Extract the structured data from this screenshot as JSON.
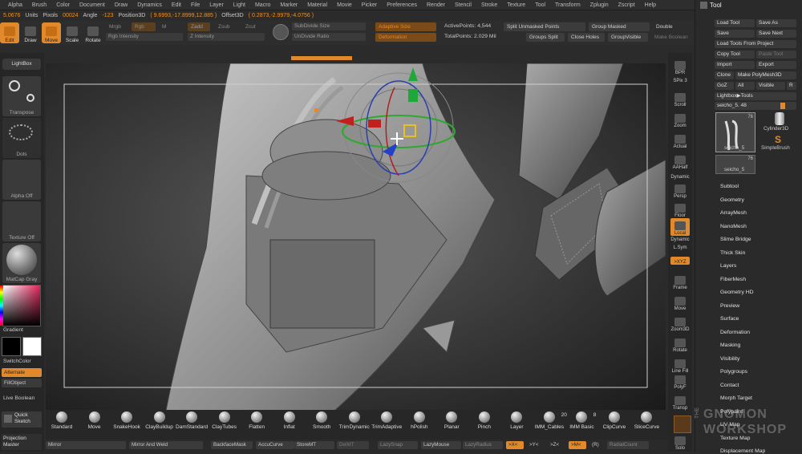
{
  "menu": [
    "Alpha",
    "Brush",
    "Color",
    "Document",
    "Draw",
    "Dynamics",
    "Edit",
    "File",
    "Layer",
    "Light",
    "Macro",
    "Marker",
    "Material",
    "Movie",
    "Picker",
    "Preferences",
    "Render",
    "Stencil",
    "Stroke",
    "Texture",
    "Tool",
    "Transform",
    "Zplugin",
    "Zscript",
    "Help"
  ],
  "status": {
    "units_val": "5.0676",
    "units": "Units",
    "pixols_lbl": "Pixols",
    "pixols": "00024",
    "angle_lbl": "Angle",
    "angle": "-123",
    "pos_lbl": "Position3D",
    "pos": "( 9.6993,-17.8999,12.885 )",
    "offset_lbl": "Offset3D",
    "offset": "( 0.2873,-2.9979,-4.0756 )"
  },
  "shelf": {
    "edit": "Edit",
    "draw": "Draw",
    "move": "Move",
    "scale": "Scale",
    "rotate": "Rotate",
    "mrgb": "Mrgb",
    "rgb": "Rgb",
    "m": "M",
    "zadd": "Zadd",
    "zsub": "Zsub",
    "zcut": "Zcut",
    "rgb_intensity": "Rgb Intensity",
    "z_intensity": "Z Intensity",
    "subdivide_size": "SubDivide Size",
    "undivide_ratio": "UnDivide Ratio",
    "adaptive_size": "Adaptive Size",
    "deformation": "Deformation",
    "active_points_lbl": "ActivePoints:",
    "active_points": "4,544",
    "total_points_lbl": "TotalPoints:",
    "total_points": "2.029 Mil",
    "split_unmasked": "Split Unmasked Points",
    "group_masked": "Group Masked",
    "double": "Double",
    "groups_split": "Groups Split",
    "close_holes": "Close Holes",
    "group_visible": "GroupVisible",
    "make_boolean": "Make Boolean"
  },
  "left": {
    "lightbox": "LightBox",
    "transpose": "Transpose",
    "dots": "Dots",
    "alpha_off": "Alpha Off",
    "texture_off": "Texture Off",
    "matcap": "MatCap Gray",
    "gradient": "Gradient",
    "switch_color": "SwitchColor",
    "alternate": "Alternate",
    "fill_object": "FillObject",
    "live_boolean": "Live Boolean",
    "quick_sketch": "Quick Sketch",
    "projection_master": "Projection Master"
  },
  "right": {
    "bpr": "BPR",
    "spix": "SPix 3",
    "scroll": "Scroll",
    "zoom": "Zoom",
    "actual": "Actual",
    "aahalf": "AAHalf",
    "dynamic": "Dynamic",
    "persp": "Persp",
    "floor": "Floor",
    "local": "Local",
    "dynamic2": "Dynamic",
    "lsym": "L.Sym",
    "xyz": ">XYZ",
    "frame": "Frame",
    "move": "Move",
    "zoom3d": "Zoom3D",
    "rotate": "Rotate",
    "line_fill": "Line Fill",
    "polyf": "PolyF",
    "transp": "Transp",
    "solo": "Solo"
  },
  "tool": {
    "title": "Tool",
    "load_tool": "Load Tool",
    "save_as": "Save As",
    "save": "Save",
    "save_next": "Save Next",
    "load_from_project": "Load Tools From Project",
    "copy_tool": "Copy Tool",
    "paste_tool": "Paste Tool",
    "import": "Import",
    "export": "Export",
    "clone": "Clone",
    "make_polymesh": "Make PolyMesh3D",
    "goz": "GoZ",
    "all": "All",
    "visible": "Visible",
    "r": "R",
    "lightbox_tools": "Lightbox▶Tools",
    "current_tool": "seicho_5.",
    "current_val": "48",
    "thumb1_label": "seicho_5",
    "thumb1_count": "76",
    "thumb2_label": "Cylinder3D",
    "thumb3_label": "SimpleBrush",
    "thumb4_label": "seicho_5",
    "thumb4_count": "76"
  },
  "subpalettes": [
    "Subtool",
    "Geometry",
    "ArrayMesh",
    "NanoMesh",
    "Slime Bridge",
    "Thick Skin",
    "Layers",
    "FiberMesh",
    "Geometry HD",
    "Preview",
    "Surface",
    "Deformation",
    "Masking",
    "Visibility",
    "Polygroups",
    "Contact",
    "Morph Target",
    "Polypaint",
    "UV Map",
    "Texture Map",
    "Displacement Map"
  ],
  "brushes": [
    "Standard",
    "Move",
    "SnakeHook",
    "ClayBuildup",
    "DamStandard",
    "ClayTubes",
    "Flatten",
    "Inflat",
    "Smooth",
    "TrimDynamic",
    "TrimAdaptive",
    "hPolish",
    "Planar",
    "Pinch",
    "Layer",
    "IMM_Cables",
    "IMM Basic",
    "ClipCurve",
    "SliceCurve"
  ],
  "brush_counts": {
    "imm_cables": "20",
    "imm_basic": "8"
  },
  "bottombar": {
    "mirror": "Mirror",
    "mirror_weld": "Mirror And Weld",
    "backface_mask": "BackfaceMask",
    "accucurve": "AccuCurve",
    "store_mt": "StoreMT",
    "del_mt": "DelMT",
    "lazy_snap": "LazySnap",
    "lazy_mouse": "LazyMouse",
    "lazy_radius": "LazyRadius",
    "x": ">X<",
    "y": ">Y<",
    "z": ">Z<",
    "m": ">M<",
    "r": "(R)",
    "radial": "RadialCount"
  },
  "watermark": {
    "the": "THE",
    "gnomon": "GNOMON",
    "workshop": "WORKSHOP"
  },
  "colors": {
    "accent": "#e28a2b",
    "panel": "#2a2a2a",
    "canvas": "#3a3a3a"
  }
}
